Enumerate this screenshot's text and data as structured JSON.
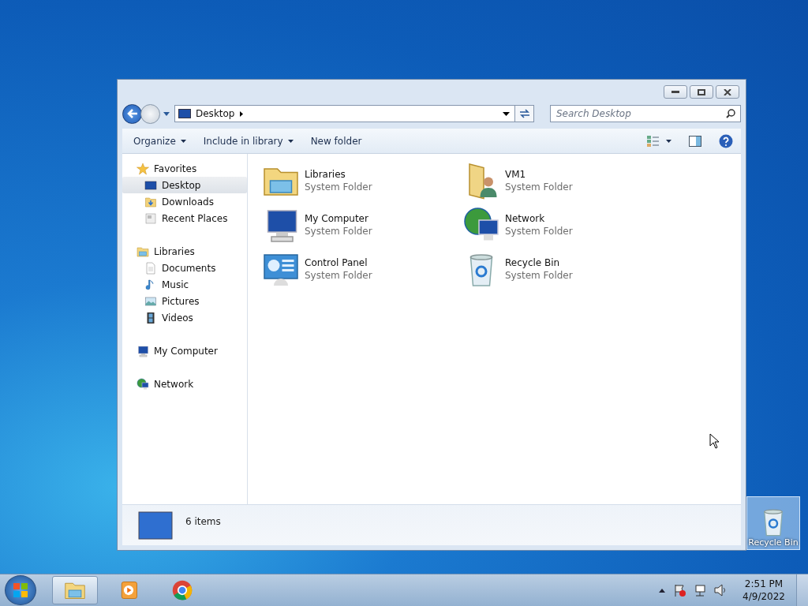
{
  "window": {
    "address": "Desktop",
    "search_placeholder": "Search Desktop"
  },
  "toolbar": [
    {
      "label": "Organize",
      "dropdown": true
    },
    {
      "label": "Include in library",
      "dropdown": true
    },
    {
      "label": "New folder",
      "dropdown": false
    }
  ],
  "navigation": [
    {
      "label": "Favorites",
      "kind": "star",
      "selected": false,
      "children": [
        {
          "label": "Desktop",
          "kind": "desktop",
          "selected": true
        },
        {
          "label": "Downloads",
          "kind": "downloads",
          "selected": false
        },
        {
          "label": "Recent Places",
          "kind": "recent",
          "selected": false
        }
      ]
    },
    {
      "label": "Libraries",
      "kind": "library",
      "selected": false,
      "children": [
        {
          "label": "Documents",
          "kind": "document",
          "selected": false
        },
        {
          "label": "Music",
          "kind": "music",
          "selected": false
        },
        {
          "label": "Pictures",
          "kind": "pictures",
          "selected": false
        },
        {
          "label": "Videos",
          "kind": "videos",
          "selected": false
        }
      ]
    },
    {
      "label": "My Computer",
      "kind": "computer",
      "selected": false
    },
    {
      "label": "Network",
      "kind": "network",
      "selected": false
    }
  ],
  "items": [
    {
      "name": "Libraries",
      "type": "System Folder",
      "kind": "library"
    },
    {
      "name": "VM1",
      "type": "System Folder",
      "kind": "user-folder"
    },
    {
      "name": "My Computer",
      "type": "System Folder",
      "kind": "computer"
    },
    {
      "name": "Network",
      "type": "System Folder",
      "kind": "network"
    },
    {
      "name": "Control Panel",
      "type": "System Folder",
      "kind": "control-panel"
    },
    {
      "name": "Recycle Bin",
      "type": "System Folder",
      "kind": "recycle-bin"
    }
  ],
  "status_bar": {
    "count": "6 items"
  },
  "desktop_icons": [
    {
      "label": "Recycle Bin",
      "kind": "recycle-bin",
      "selected": true
    }
  ],
  "taskbar": {
    "apps": [
      {
        "kind": "library",
        "selected": true
      },
      {
        "kind": "media",
        "selected": false
      },
      {
        "kind": "browser",
        "selected": false
      }
    ],
    "time": "2:51 PM",
    "date": "4/9/2022"
  }
}
